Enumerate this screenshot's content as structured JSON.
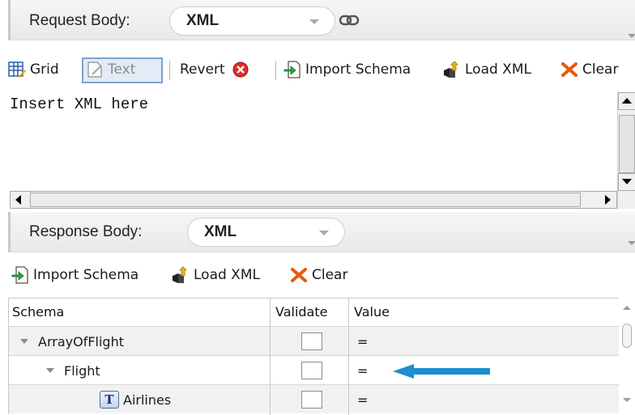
{
  "request": {
    "label": "Request Body:",
    "format": "XML",
    "toolbar": {
      "grid": "Grid",
      "text": "Text",
      "revert": "Revert",
      "import_schema": "Import Schema",
      "load_xml": "Load XML",
      "clear": "Clear"
    },
    "text": "Insert XML here"
  },
  "response": {
    "label": "Response Body:",
    "format": "XML",
    "toolbar": {
      "import_schema": "Import Schema",
      "load_xml": "Load XML",
      "clear": "Clear"
    },
    "table": {
      "headers": [
        "Schema",
        "Validate",
        "Value"
      ],
      "rows": [
        {
          "name": "ArrayOfFlight",
          "value": "="
        },
        {
          "name": "Flight",
          "value": "="
        },
        {
          "name": "Airlines",
          "value": "="
        }
      ]
    }
  },
  "colors": {
    "arrow": "#1b8fd0",
    "selected_button": "#e2ebf6",
    "clear_x": "#e35b0e"
  },
  "icons": [
    "grid-icon",
    "text-icon",
    "revert-icon",
    "import-schema-icon",
    "load-xml-icon",
    "clear-icon",
    "link-icon",
    "text-type-icon"
  ]
}
